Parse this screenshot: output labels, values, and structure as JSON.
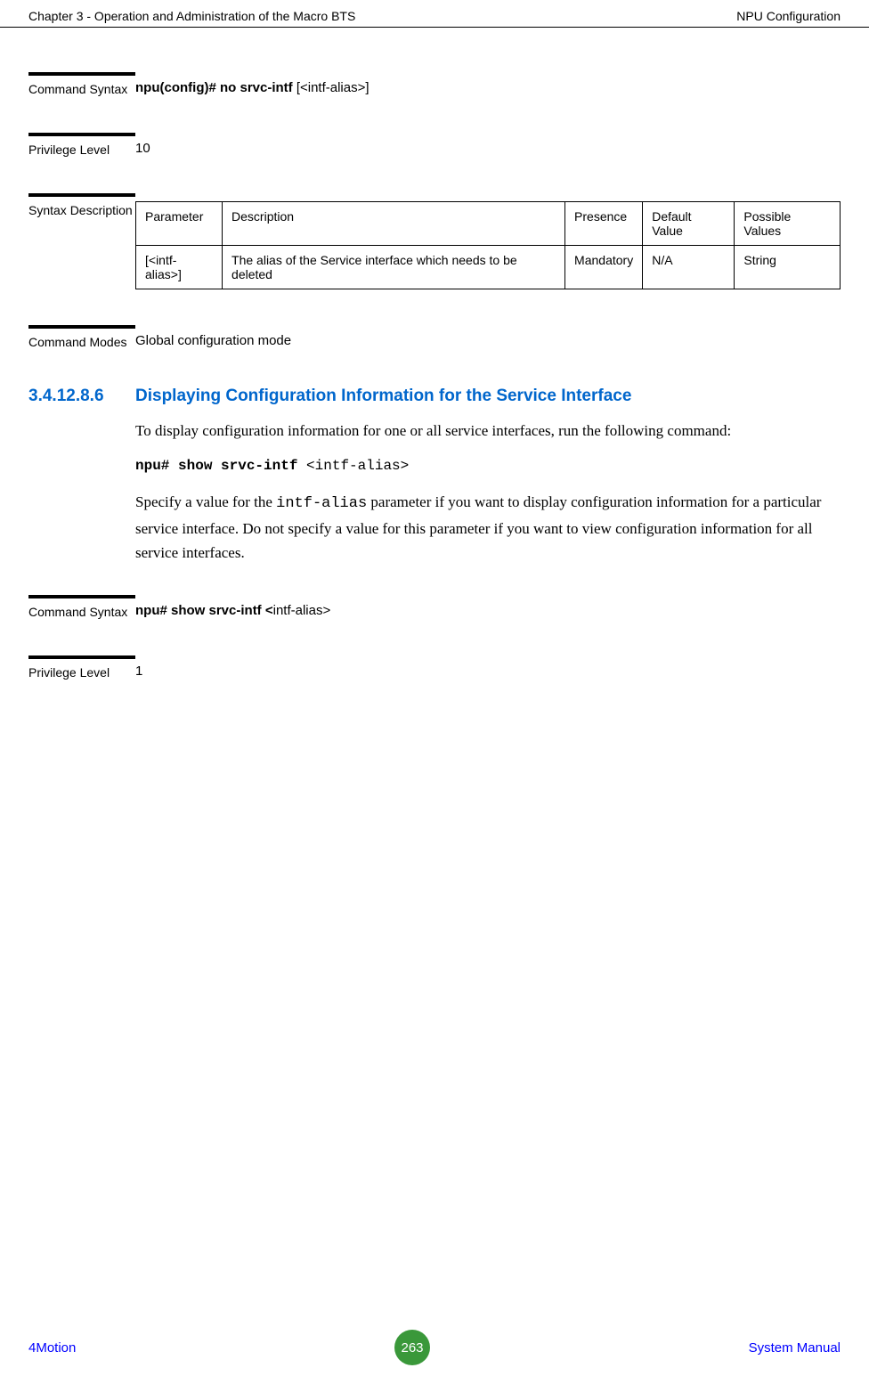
{
  "header": {
    "left": "Chapter 3 - Operation and Administration of the Macro BTS",
    "right": "NPU Configuration"
  },
  "defs": {
    "command_syntax_label": "Command Syntax",
    "command_syntax_value_prefix": "npu(config)# no srvc-intf ",
    "command_syntax_value_suffix": "[<intf-alias>]",
    "privilege_level_label": "Privilege Level",
    "privilege_level_value": "10",
    "syntax_desc_label": "Syntax Description",
    "command_modes_label": "Command Modes",
    "command_modes_value": "Global configuration mode"
  },
  "param_table": {
    "headers": [
      "Parameter",
      "Description",
      "Presence",
      "Default Value",
      "Possible Values"
    ],
    "row": {
      "parameter": "[<intf-alias>]",
      "description": "The alias of the Service interface which needs to be deleted",
      "presence": "Mandatory",
      "default": "N/A",
      "possible": "String"
    }
  },
  "section": {
    "number": "3.4.12.8.6",
    "title": "Displaying Configuration Information for the Service Interface",
    "para1": " To display configuration information for one or all service interfaces, run the following command:",
    "code_bold": "npu# show srvc-intf ",
    "code_arg": "<intf-alias>",
    "para2_pre": "Specify a value for the ",
    "para2_mono": "intf-alias",
    "para2_post": " parameter if you want to display configuration information for a particular service interface. Do not specify a value for this parameter if you want to view configuration information for all service interfaces."
  },
  "defs2": {
    "command_syntax_label": "Command Syntax",
    "command_syntax_value_prefix": "npu# show srvc-intf <",
    "command_syntax_value_suffix": "intf-alias>",
    "privilege_level_label": "Privilege Level",
    "privilege_level_value": "1"
  },
  "footer": {
    "left": "4Motion",
    "page": "263",
    "right": "System Manual"
  }
}
